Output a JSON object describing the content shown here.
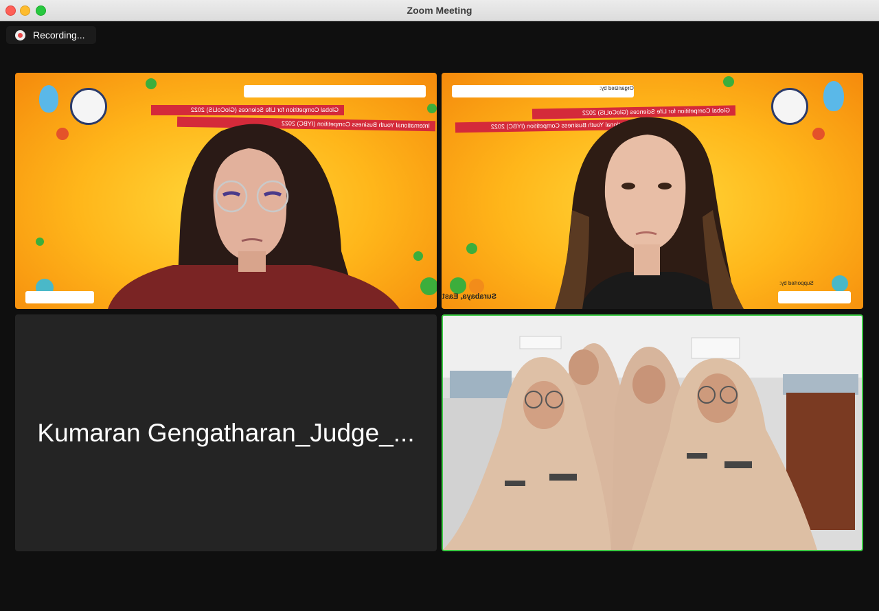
{
  "window": {
    "title": "Zoom Meeting"
  },
  "recording": {
    "label": "Recording..."
  },
  "participants": [
    {
      "kind": "video",
      "backdrop_banner_1": "Global Competition for Life Sciences (GloCoLiS) 2022",
      "backdrop_banner_2": "International Youth Business Competition (IYBC) 2022"
    },
    {
      "kind": "video",
      "backdrop_banner_1": "Global Competition for Life Sciences (GloCoLiS) 2022",
      "backdrop_banner_2": "International Youth Business Competition (IYBC) 2022",
      "location_text": "Surabaya, East Java",
      "supported_by": "Supported by:",
      "organized_by": "Organized by:"
    },
    {
      "kind": "name",
      "display_name": "Kumaran Gengatharan_Judge_..."
    },
    {
      "kind": "video",
      "active_speaker": true
    }
  ],
  "colors": {
    "active_speaker_border": "#3ccb45",
    "recording_dot": "#e94a4a",
    "banner_red": "#d42a3a",
    "backdrop_orange": "#ffb61a"
  },
  "icons": [
    "recording-dot-icon",
    "close-window-icon",
    "minimize-window-icon",
    "zoom-window-icon"
  ]
}
